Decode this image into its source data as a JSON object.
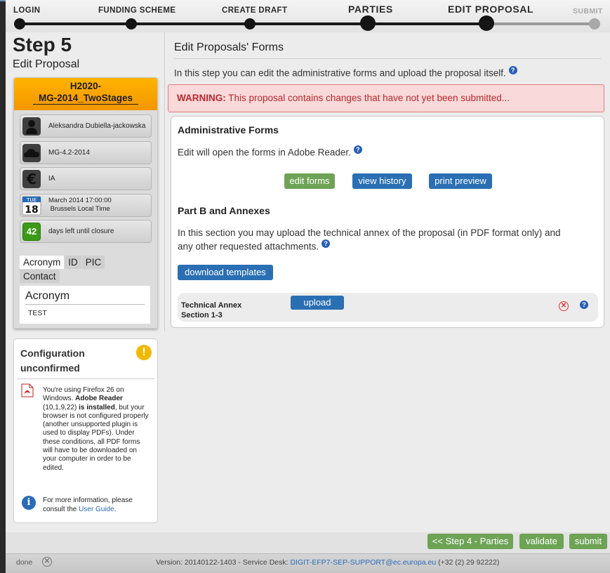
{
  "progress": {
    "steps": [
      {
        "label": "LOGIN"
      },
      {
        "label": "FUNDING SCHEME"
      },
      {
        "label": "CREATE DRAFT"
      },
      {
        "label": "PARTIES"
      },
      {
        "label": "EDIT PROPOSAL"
      },
      {
        "label": "SUBMIT"
      }
    ]
  },
  "step": {
    "title": "Step 5",
    "subtitle": "Edit Proposal"
  },
  "call": {
    "line1": "H2020-",
    "line2": "MG-2014_TwoStages",
    "coordinator": "Aleksandra Dubiella-jackowska",
    "topic": "MG-4.2-2014",
    "type": "IA",
    "calendar": {
      "day": "TUE",
      "date": "18"
    },
    "deadline_line1": "March 2014  17:00:00",
    "deadline_line2": " Brussels Local Time",
    "days_left": "42",
    "days_left_label": "days left until closure"
  },
  "tabs": {
    "acronym": "Acronym",
    "id": "ID",
    "pic": "PIC",
    "contact": "Contact"
  },
  "acronym": {
    "heading": "Acronym",
    "value": "TEST"
  },
  "config": {
    "title_line1": "Configuration",
    "title_line2": "unconfirmed",
    "warn_symbol": "!",
    "info_symbol": "i",
    "text_pre": "You're using Firefox 26 on Windows. ",
    "text_bold1": "Adobe Reader",
    "text_mid": " (10,1,9,22) ",
    "text_bold2": "is installed",
    "text_post": ", but your browser is not configured properly (another unsupported plugin is used to display PDFs). Under these conditions, all PDF forms will have to be downloaded on your computer in order to be edited.",
    "more_pre": "For more information, please consult the ",
    "more_link": "User Guide",
    "more_post": "."
  },
  "main": {
    "title": "Edit Proposals' Forms",
    "intro": "In this step you can edit the administrative forms and upload the proposal itself.",
    "help_symbol": "?",
    "warning_label": "WARNING:",
    "warning_text": " This proposal contains changes that have not yet been submitted...",
    "admin_heading": "Administrative Forms",
    "admin_text": "Edit will open the forms in Adobe Reader.",
    "btn_edit_forms": "edit forms",
    "btn_view_history": "view history",
    "btn_print_preview": "print preview",
    "partb_heading": "Part B and Annexes",
    "partb_text_line1": "In this section you may upload the technical annex of the proposal (in PDF format only) and",
    "partb_text_line2": "any other requested attachments.",
    "btn_download_templates": "download templates",
    "tech_label": "Technical Annex Section 1-3",
    "btn_upload": "upload",
    "remove_symbol": "✕"
  },
  "footer": {
    "btn_back": "<< Step 4 - Parties",
    "btn_validate": "validate",
    "btn_submit": "submit"
  },
  "status": {
    "done": "done",
    "stop_symbol": "✕",
    "version": "Version: 20140122-1403 - Service Desk: ",
    "email": "DIGIT-EFP7-SEP-SUPPORT@ec.europa.eu",
    "phone": " (+32 (2) 29 92222)"
  },
  "colors": {
    "accent_orange": "#f39600",
    "button_green": "#6ea356",
    "button_blue": "#2a6fb3",
    "warning_red": "#b8282e"
  }
}
